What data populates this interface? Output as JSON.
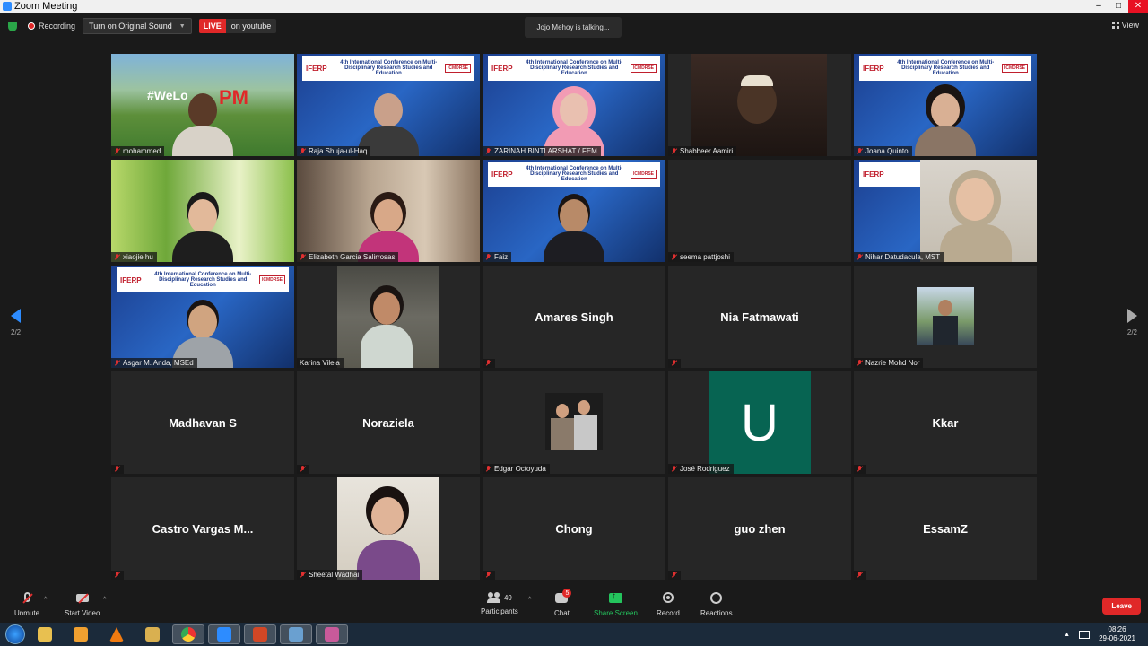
{
  "window": {
    "title": "Zoom Meeting"
  },
  "topbar": {
    "recording_label": "Recording",
    "original_sound_label": "Turn on Original Sound",
    "live_badge": "LIVE",
    "live_destination": "on youtube",
    "talking_text": "Jojo Mehoy is talking...",
    "view_label": "View"
  },
  "pagination": {
    "left": "2/2",
    "right": "2/2"
  },
  "banner": {
    "logo": "IFERP",
    "conference": "4th International Conference on Multi-Disciplinary Research Studies and Education",
    "tag": "ICMDRSE"
  },
  "participants": [
    {
      "name": "mohammed",
      "kind": "video"
    },
    {
      "name": "Raja Shuja-ul-Haq",
      "kind": "video"
    },
    {
      "name": "ZARINAH BINTI ARSHAT / FEM",
      "kind": "video"
    },
    {
      "name": "Shabbeer Aamiri",
      "kind": "video"
    },
    {
      "name": "Joana Quinto",
      "kind": "video"
    },
    {
      "name": "xiaojie hu",
      "kind": "video"
    },
    {
      "name": "Elizabeth Garcia Salirrosas",
      "kind": "video"
    },
    {
      "name": "Faiz",
      "kind": "video"
    },
    {
      "name": "seema pattjoshi",
      "kind": "blank"
    },
    {
      "name": "Nihar Datudacula, MST",
      "kind": "video"
    },
    {
      "name": "Asgar M. Anda, MSEd",
      "kind": "video"
    },
    {
      "name": "Karina Vilela",
      "kind": "photo"
    },
    {
      "name": "",
      "display_name": "Amares Singh",
      "kind": "text"
    },
    {
      "name": "",
      "display_name": "Nia Fatmawati",
      "kind": "text"
    },
    {
      "name": "Nazrie Mohd Nor",
      "kind": "small-photo"
    },
    {
      "name": "",
      "display_name": "Madhavan S",
      "kind": "text"
    },
    {
      "name": "",
      "display_name": "Noraziela",
      "kind": "text"
    },
    {
      "name": "Edgar Octoyuda",
      "kind": "small-photo"
    },
    {
      "name": "José Rodriguez",
      "kind": "initial",
      "initial": "U"
    },
    {
      "name": "",
      "display_name": "Kkar",
      "kind": "text"
    },
    {
      "name": "",
      "display_name": "Castro Vargas M...",
      "kind": "text"
    },
    {
      "name": "Sheetal Wadhai",
      "kind": "photo"
    },
    {
      "name": "",
      "display_name": "Chong",
      "kind": "text"
    },
    {
      "name": "",
      "display_name": "guo zhen",
      "kind": "text"
    },
    {
      "name": "",
      "display_name": "EssamZ",
      "kind": "text"
    }
  ],
  "toolbar": {
    "unmute": "Unmute",
    "start_video": "Start Video",
    "participants_label": "Participants",
    "participants_count": "49",
    "chat_label": "Chat",
    "chat_badge": "5",
    "share_label": "Share Screen",
    "record_label": "Record",
    "reactions_label": "Reactions",
    "leave_label": "Leave"
  },
  "taskbar": {
    "time": "08:26",
    "date": "29-06-2021"
  }
}
